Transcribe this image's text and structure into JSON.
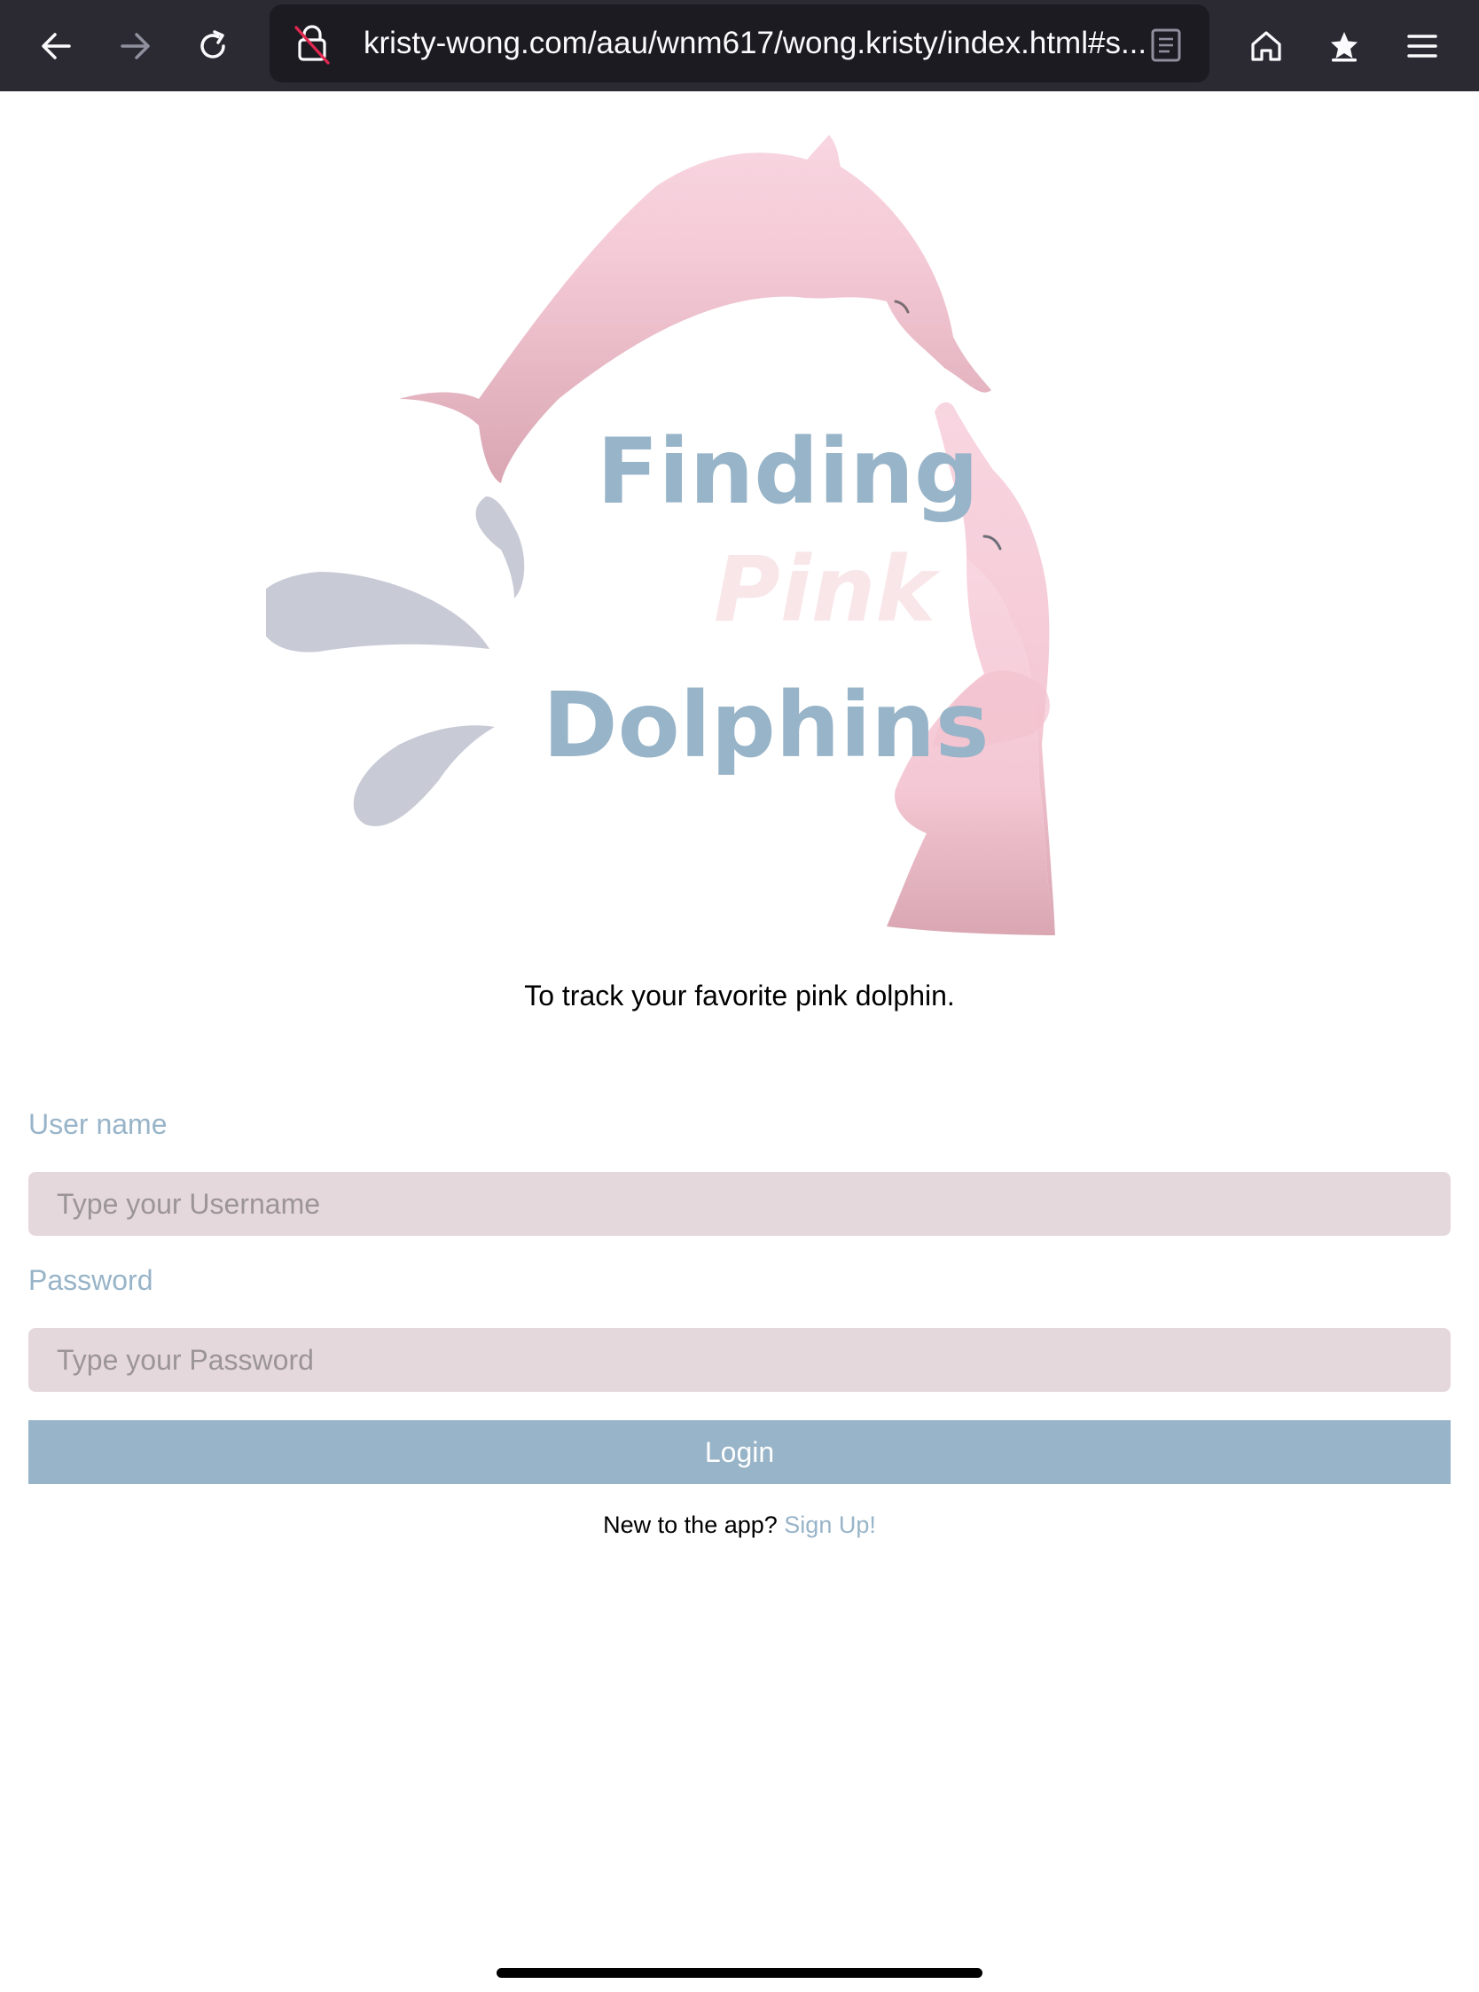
{
  "browser": {
    "url": "kristy-wong.com/aau/wnm617/wong.kristy/index.html#s...",
    "icons": [
      "back-icon",
      "forward-icon",
      "reload-icon",
      "insecure-lock-icon",
      "reader-view-icon",
      "home-icon",
      "bookmarks-icon",
      "menu-icon"
    ]
  },
  "hero": {
    "title_line1": "Finding",
    "title_line2": "Pink",
    "title_line3": "Dolphins",
    "colors": {
      "title_blue": "#98b4c8",
      "title_pink": "#f9e6e8",
      "dolphin_light": "#f8d6e1",
      "dolphin_dark": "#d9a6b2",
      "splash": "#c8cbd6"
    }
  },
  "tagline": "To track your favorite pink dolphin.",
  "form": {
    "username_label": "User name",
    "username_placeholder": "Type your Username",
    "password_label": "Password",
    "password_placeholder": "Type your Password",
    "login_label": "Login"
  },
  "signup": {
    "prompt": "New to the app?",
    "link_label": "Sign Up!"
  }
}
